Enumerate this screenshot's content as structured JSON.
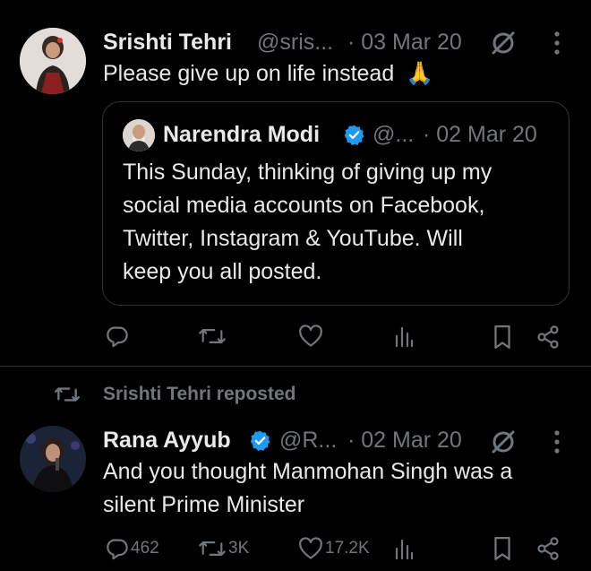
{
  "tweet1": {
    "author_name": "Srishti Tehri",
    "handle": "@sris...",
    "date": "· 03 Mar 20",
    "text": "Please give up on life instead",
    "emoji": "🙏",
    "quote": {
      "author_name": "Narendra Modi",
      "handle": "@...",
      "date": "· 02 Mar 20",
      "lines": [
        "This Sunday, thinking of giving up my",
        "social media accounts on Facebook,",
        "Twitter, Instagram & YouTube. Will",
        "keep you all posted."
      ]
    }
  },
  "repost_banner": "Srishti Tehri reposted",
  "tweet2": {
    "author_name": "Rana Ayyub",
    "handle": "@R...",
    "date": "· 02 Mar 20",
    "lines": [
      "And you thought Manmohan Singh was a",
      "silent Prime Minister"
    ],
    "replies": "462",
    "reposts": "3K",
    "likes": "17.2K"
  },
  "colors": {
    "background": "#000000",
    "text": "#e7e9ea",
    "muted": "#71767b",
    "verified_badge": "#1d9bf0",
    "border": "#2f3336"
  },
  "icons": [
    "ellipsis-icon",
    "grok-icon",
    "verified-badge-icon",
    "reply-icon",
    "repost-icon",
    "like-icon",
    "views-icon",
    "bookmark-icon",
    "share-icon"
  ]
}
